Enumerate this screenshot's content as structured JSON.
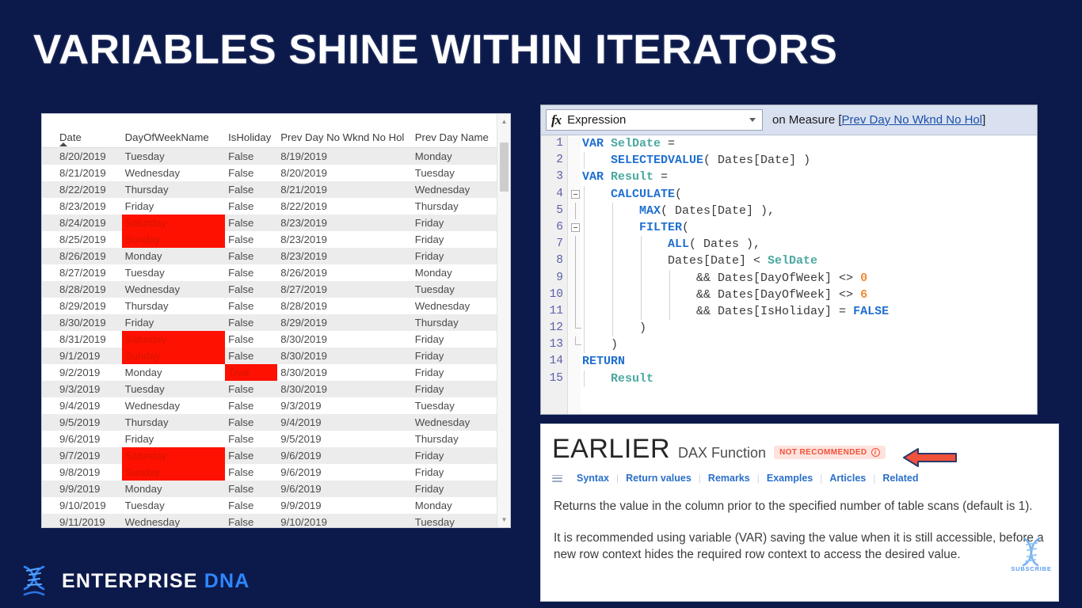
{
  "slide": {
    "title": "VARIABLES SHINE WITHIN ITERATORS",
    "background_color": "#0c1a4b"
  },
  "data_table": {
    "columns": [
      "Date",
      "DayOfWeekName",
      "IsHoliday",
      "Prev Day No Wknd No Hol",
      "Prev Day Name"
    ],
    "sort_column": "Date",
    "sort_direction": "ascending",
    "highlight_color": "#fe1100",
    "rows": [
      {
        "date": "8/20/2019",
        "dow": "Tuesday",
        "holiday": "False",
        "prev": "8/19/2019",
        "prevname": "Monday",
        "hl": ""
      },
      {
        "date": "8/21/2019",
        "dow": "Wednesday",
        "holiday": "False",
        "prev": "8/20/2019",
        "prevname": "Tuesday",
        "hl": ""
      },
      {
        "date": "8/22/2019",
        "dow": "Thursday",
        "holiday": "False",
        "prev": "8/21/2019",
        "prevname": "Wednesday",
        "hl": ""
      },
      {
        "date": "8/23/2019",
        "dow": "Friday",
        "holiday": "False",
        "prev": "8/22/2019",
        "prevname": "Thursday",
        "hl": ""
      },
      {
        "date": "8/24/2019",
        "dow": "Saturday",
        "holiday": "False",
        "prev": "8/23/2019",
        "prevname": "Friday",
        "hl": "dow"
      },
      {
        "date": "8/25/2019",
        "dow": "Sunday",
        "holiday": "False",
        "prev": "8/23/2019",
        "prevname": "Friday",
        "hl": "dow"
      },
      {
        "date": "8/26/2019",
        "dow": "Monday",
        "holiday": "False",
        "prev": "8/23/2019",
        "prevname": "Friday",
        "hl": ""
      },
      {
        "date": "8/27/2019",
        "dow": "Tuesday",
        "holiday": "False",
        "prev": "8/26/2019",
        "prevname": "Monday",
        "hl": ""
      },
      {
        "date": "8/28/2019",
        "dow": "Wednesday",
        "holiday": "False",
        "prev": "8/27/2019",
        "prevname": "Tuesday",
        "hl": ""
      },
      {
        "date": "8/29/2019",
        "dow": "Thursday",
        "holiday": "False",
        "prev": "8/28/2019",
        "prevname": "Wednesday",
        "hl": ""
      },
      {
        "date": "8/30/2019",
        "dow": "Friday",
        "holiday": "False",
        "prev": "8/29/2019",
        "prevname": "Thursday",
        "hl": ""
      },
      {
        "date": "8/31/2019",
        "dow": "Saturday",
        "holiday": "False",
        "prev": "8/30/2019",
        "prevname": "Friday",
        "hl": "dow"
      },
      {
        "date": "9/1/2019",
        "dow": "Sunday",
        "holiday": "False",
        "prev": "8/30/2019",
        "prevname": "Friday",
        "hl": "dow"
      },
      {
        "date": "9/2/2019",
        "dow": "Monday",
        "holiday": "True",
        "prev": "8/30/2019",
        "prevname": "Friday",
        "hl": "holiday"
      },
      {
        "date": "9/3/2019",
        "dow": "Tuesday",
        "holiday": "False",
        "prev": "8/30/2019",
        "prevname": "Friday",
        "hl": ""
      },
      {
        "date": "9/4/2019",
        "dow": "Wednesday",
        "holiday": "False",
        "prev": "9/3/2019",
        "prevname": "Tuesday",
        "hl": ""
      },
      {
        "date": "9/5/2019",
        "dow": "Thursday",
        "holiday": "False",
        "prev": "9/4/2019",
        "prevname": "Wednesday",
        "hl": ""
      },
      {
        "date": "9/6/2019",
        "dow": "Friday",
        "holiday": "False",
        "prev": "9/5/2019",
        "prevname": "Thursday",
        "hl": ""
      },
      {
        "date": "9/7/2019",
        "dow": "Saturday",
        "holiday": "False",
        "prev": "9/6/2019",
        "prevname": "Friday",
        "hl": "dow"
      },
      {
        "date": "9/8/2019",
        "dow": "Sunday",
        "holiday": "False",
        "prev": "9/6/2019",
        "prevname": "Friday",
        "hl": "dow"
      },
      {
        "date": "9/9/2019",
        "dow": "Monday",
        "holiday": "False",
        "prev": "9/6/2019",
        "prevname": "Friday",
        "hl": ""
      },
      {
        "date": "9/10/2019",
        "dow": "Tuesday",
        "holiday": "False",
        "prev": "9/9/2019",
        "prevname": "Monday",
        "hl": ""
      },
      {
        "date": "9/11/2019",
        "dow": "Wednesday",
        "holiday": "False",
        "prev": "9/10/2019",
        "prevname": "Tuesday",
        "hl": ""
      }
    ]
  },
  "code_editor": {
    "fx_icon": "fx",
    "expression_selected": "Expression",
    "on_measure_prefix": "on Measure [",
    "measure_name": "Prev Day No Wknd No Hol",
    "on_measure_suffix": "]",
    "lines": [
      {
        "n": "1",
        "text": "VAR SelDate ="
      },
      {
        "n": "2",
        "text": "    SELECTEDVALUE( Dates[Date] )"
      },
      {
        "n": "3",
        "text": "VAR Result ="
      },
      {
        "n": "4",
        "text": "    CALCULATE("
      },
      {
        "n": "5",
        "text": "        MAX( Dates[Date] ),"
      },
      {
        "n": "6",
        "text": "        FILTER("
      },
      {
        "n": "7",
        "text": "            ALL( Dates ),"
      },
      {
        "n": "8",
        "text": "            Dates[Date] < SelDate"
      },
      {
        "n": "9",
        "text": "                && Dates[DayOfWeek] <> 0"
      },
      {
        "n": "10",
        "text": "                && Dates[DayOfWeek] <> 6"
      },
      {
        "n": "11",
        "text": "                && Dates[IsHoliday] = FALSE"
      },
      {
        "n": "12",
        "text": "        )"
      },
      {
        "n": "13",
        "text": "    )"
      },
      {
        "n": "14",
        "text": "RETURN"
      },
      {
        "n": "15",
        "text": "    Result"
      }
    ]
  },
  "doc_panel": {
    "title": "EARLIER",
    "subtitle": "DAX Function",
    "badge": "NOT RECOMMENDED",
    "badge_info_icon": "info-circle-icon",
    "nav": [
      "Syntax",
      "Return values",
      "Remarks",
      "Examples",
      "Articles",
      "Related"
    ],
    "paragraph_1": "Returns the value in the column prior to the specified number of table scans (default is 1).",
    "paragraph_2": "It is recommended using variable (VAR) saving the value when it is still accessible, before a new row context hides the required row context to access the desired value."
  },
  "annotation": {
    "arrow": "left-arrow-annotation",
    "arrow_fill": "#f0523a",
    "arrow_stroke": "#2b3a6b"
  },
  "footer": {
    "brand_first": "ENTERPRISE",
    "brand_second": "DNA",
    "logo_icon": "dna-helix-icon"
  },
  "watermark": {
    "label": "SUBSCRIBE",
    "icon": "dna-helix-icon"
  }
}
